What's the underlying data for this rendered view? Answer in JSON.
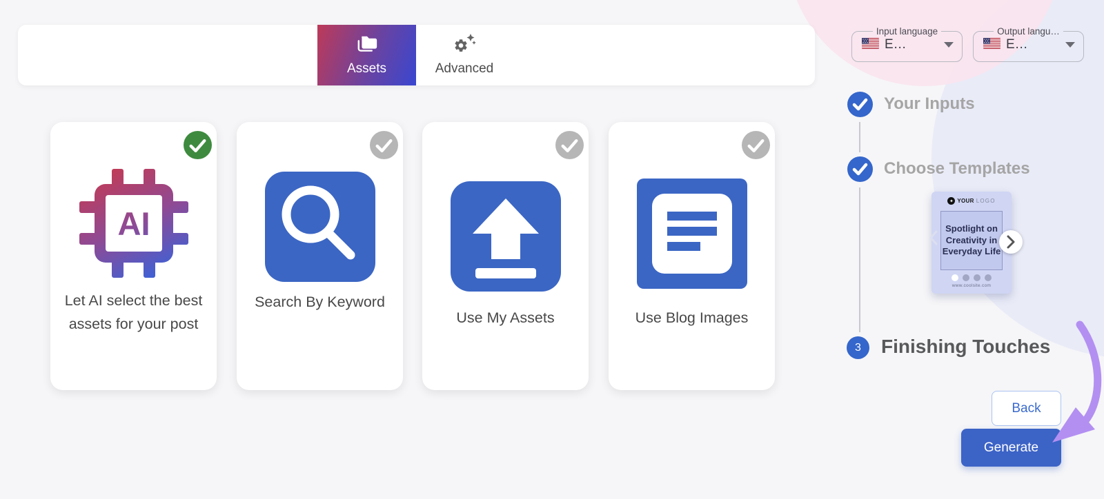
{
  "topbar": {
    "tabs": [
      {
        "label": "Assets",
        "active": true
      },
      {
        "label": "Advanced",
        "active": false
      }
    ]
  },
  "cards": [
    {
      "label": "Let AI select the best assets for your post",
      "selected": true
    },
    {
      "label": "Search By Keyword",
      "selected": false
    },
    {
      "label": "Use My Assets",
      "selected": false
    },
    {
      "label": "Use Blog Images",
      "selected": false
    }
  ],
  "language": {
    "input": {
      "label": "Input language",
      "value": "E…",
      "flag": "us-flag"
    },
    "output": {
      "label": "Output langu…",
      "value": "E…",
      "flag": "us-flag"
    }
  },
  "steps": {
    "step1": {
      "label": "Your Inputs",
      "status": "done"
    },
    "step2": {
      "label": "Choose Templates",
      "status": "done"
    },
    "step3": {
      "label": "Finishing Touches",
      "number": "3",
      "status": "current"
    }
  },
  "preview": {
    "logo_word": "YOUR",
    "logo_word2": "LOGO",
    "line1": "Spotlight on",
    "line2": "Creativity in",
    "line3": "Everyday Life",
    "website": "www.coolsite.com",
    "dots": 4,
    "active_dot": 1
  },
  "buttons": {
    "back": "Back",
    "generate": "Generate"
  },
  "colors": {
    "accent_blue": "#3b66c4",
    "step_blue": "#3466cb",
    "tab_gradient_from": "#bd3a58",
    "tab_gradient_to": "#3947d0",
    "success_green": "#3e8b3f",
    "unselected_gray": "#b6b6b6",
    "arrow_purple": "#b38ff2",
    "preview_bg": "#cfd5f3"
  }
}
